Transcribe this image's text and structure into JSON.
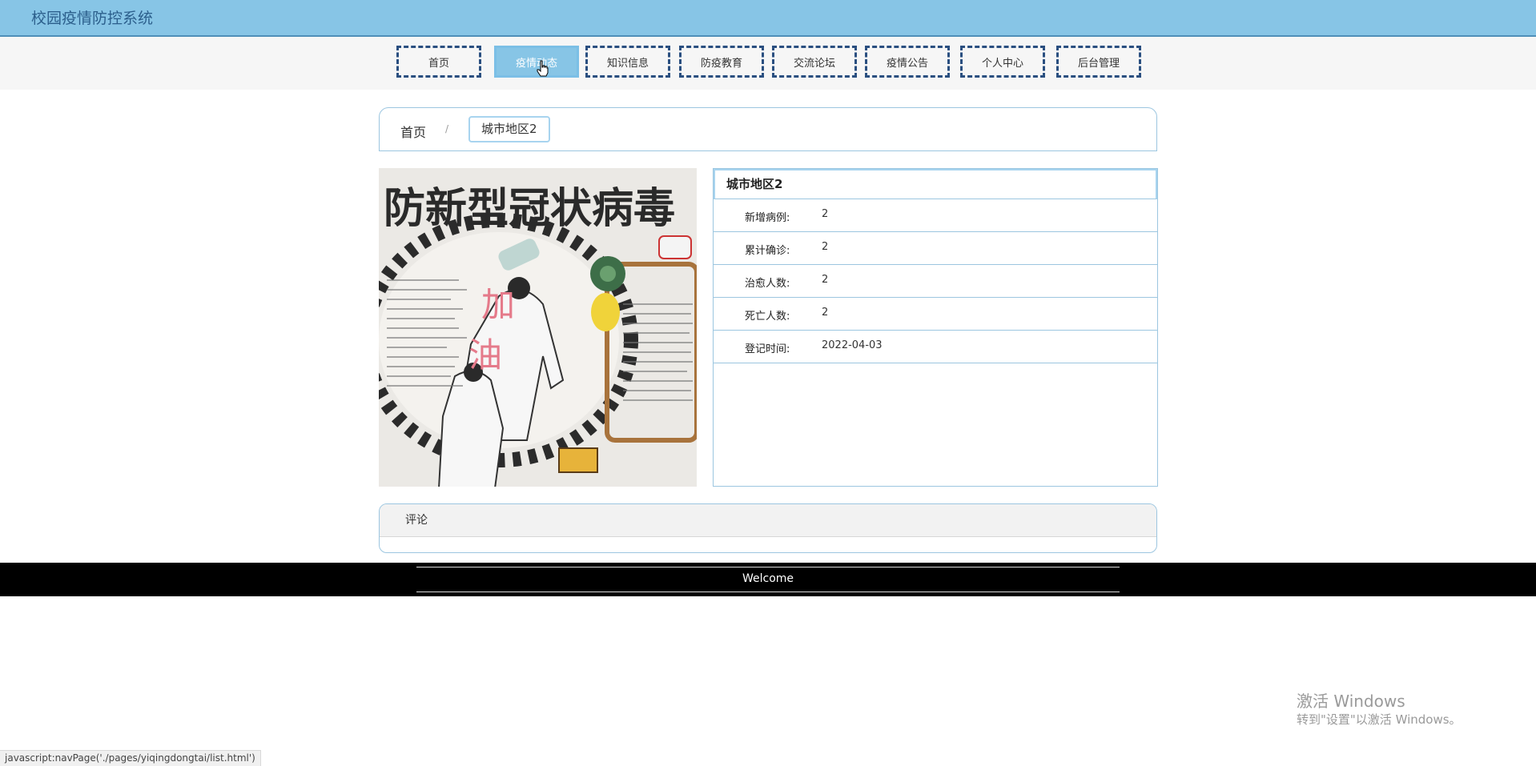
{
  "header": {
    "site_title": "校园疫情防控系统"
  },
  "nav": {
    "items": [
      {
        "label": "首页"
      },
      {
        "label": "疫情动态"
      },
      {
        "label": "知识信息"
      },
      {
        "label": "防疫教育"
      },
      {
        "label": "交流论坛"
      },
      {
        "label": "疫情公告"
      },
      {
        "label": "个人中心"
      },
      {
        "label": "后台管理"
      }
    ],
    "active_index": 1
  },
  "breadcrumb": {
    "home": "首页",
    "separator": "/",
    "current": "城市地区2"
  },
  "photo": {
    "poster_title": "防新型冠状病毒",
    "poster_slogan_1": "加",
    "poster_slogan_2": "油"
  },
  "detail": {
    "title": "城市地区2",
    "rows": [
      {
        "label": "新增病例:",
        "value": "2"
      },
      {
        "label": "累计确诊:",
        "value": "2"
      },
      {
        "label": "治愈人数:",
        "value": "2"
      },
      {
        "label": "死亡人数:",
        "value": "2"
      },
      {
        "label": "登记时间:",
        "value": "2022-04-03"
      }
    ]
  },
  "comments": {
    "heading": "评论"
  },
  "footer": {
    "text": "Welcome"
  },
  "os_watermark": {
    "line1": "激活 Windows",
    "line2": "转到\"设置\"以激活 Windows。"
  },
  "status_bar": {
    "text": "javascript:navPage('./pages/yiqingdongtai/list.html')"
  },
  "colors": {
    "header_bg": "#87c5e6",
    "nav_border": "#2a4f80",
    "active_bg": "#87c5e6",
    "panel_border": "#9cc6e0",
    "footer_bg": "#000000"
  }
}
